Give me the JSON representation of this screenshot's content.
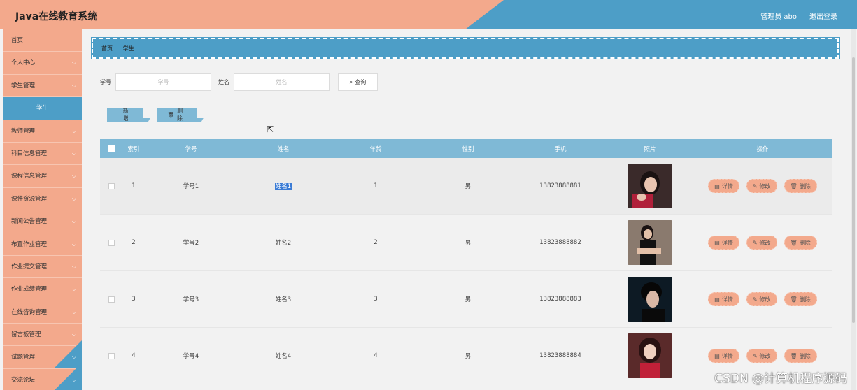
{
  "header": {
    "title": "Java在线教育系统",
    "user": "管理员 abo",
    "logout": "退出登录"
  },
  "sidebar": {
    "items": [
      {
        "label": "首页",
        "chevron": ""
      },
      {
        "label": "个人中心",
        "chevron": "⌵"
      },
      {
        "label": "学生管理",
        "chevron": "⌵"
      },
      {
        "label": "学生",
        "chevron": ""
      },
      {
        "label": "教师管理",
        "chevron": "⌵"
      },
      {
        "label": "科目信息管理",
        "chevron": "⌵"
      },
      {
        "label": "课程信息管理",
        "chevron": "⌵"
      },
      {
        "label": "课件资源管理",
        "chevron": "⌵"
      },
      {
        "label": "新闻公告管理",
        "chevron": "⌵"
      },
      {
        "label": "布置作业管理",
        "chevron": "⌵"
      },
      {
        "label": "作业提交管理",
        "chevron": "⌵"
      },
      {
        "label": "作业成绩管理",
        "chevron": "⌵"
      },
      {
        "label": "在线咨询管理",
        "chevron": "⌵"
      },
      {
        "label": "留言板管理",
        "chevron": "⌵"
      },
      {
        "label": "试题管理",
        "chevron": "⌵"
      },
      {
        "label": "交流论坛",
        "chevron": "⌵"
      }
    ]
  },
  "breadcrumb": {
    "home": "首页",
    "sep": "|",
    "current": "学生"
  },
  "search": {
    "label_no": "学号",
    "placeholder_no": "学号",
    "label_name": "姓名",
    "placeholder_name": "姓名",
    "query_icon": "⌕",
    "query": "查询"
  },
  "actions": {
    "add_icon": "+",
    "add": "新增",
    "delete_icon": "🗑",
    "delete": "删除"
  },
  "table": {
    "headers": [
      "索引",
      "学号",
      "姓名",
      "年龄",
      "性别",
      "手机",
      "照片",
      "操作"
    ],
    "rows": [
      {
        "idx": "1",
        "no": "学号1",
        "name": "姓名1",
        "age": "1",
        "sex": "男",
        "phone": "13823888881"
      },
      {
        "idx": "2",
        "no": "学号2",
        "name": "姓名2",
        "age": "2",
        "sex": "男",
        "phone": "13823888882"
      },
      {
        "idx": "3",
        "no": "学号3",
        "name": "姓名3",
        "age": "3",
        "sex": "男",
        "phone": "13823888883"
      },
      {
        "idx": "4",
        "no": "学号4",
        "name": "姓名4",
        "age": "4",
        "sex": "男",
        "phone": "13823888884"
      }
    ],
    "ops": {
      "detail_icon": "▤",
      "detail": "详情",
      "edit_icon": "✎",
      "edit": "修改",
      "delete_icon": "🗑",
      "delete": "删除"
    }
  },
  "watermark": "CSDN @计算机程序源码",
  "colors": {
    "primary_blue": "#4d9ec7",
    "table_header": "#7fb9d6",
    "salmon": "#f3a98c"
  }
}
